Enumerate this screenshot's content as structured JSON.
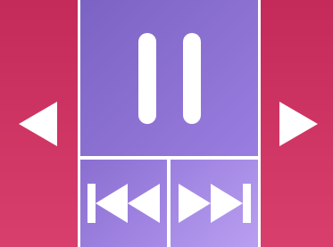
{
  "controls": {
    "previous": {
      "icon": "arrow-left-icon",
      "color": "#c42a5a"
    },
    "next": {
      "icon": "arrow-right-icon",
      "color": "#c42a5a"
    },
    "pause": {
      "icon": "pause-icon",
      "color": "#7b63c3"
    },
    "rewind": {
      "icon": "skip-back-icon",
      "color": "#8a6fd0"
    },
    "fast_forward": {
      "icon": "skip-forward-icon",
      "color": "#b99ff0"
    },
    "icon_color": "#ffffff"
  }
}
